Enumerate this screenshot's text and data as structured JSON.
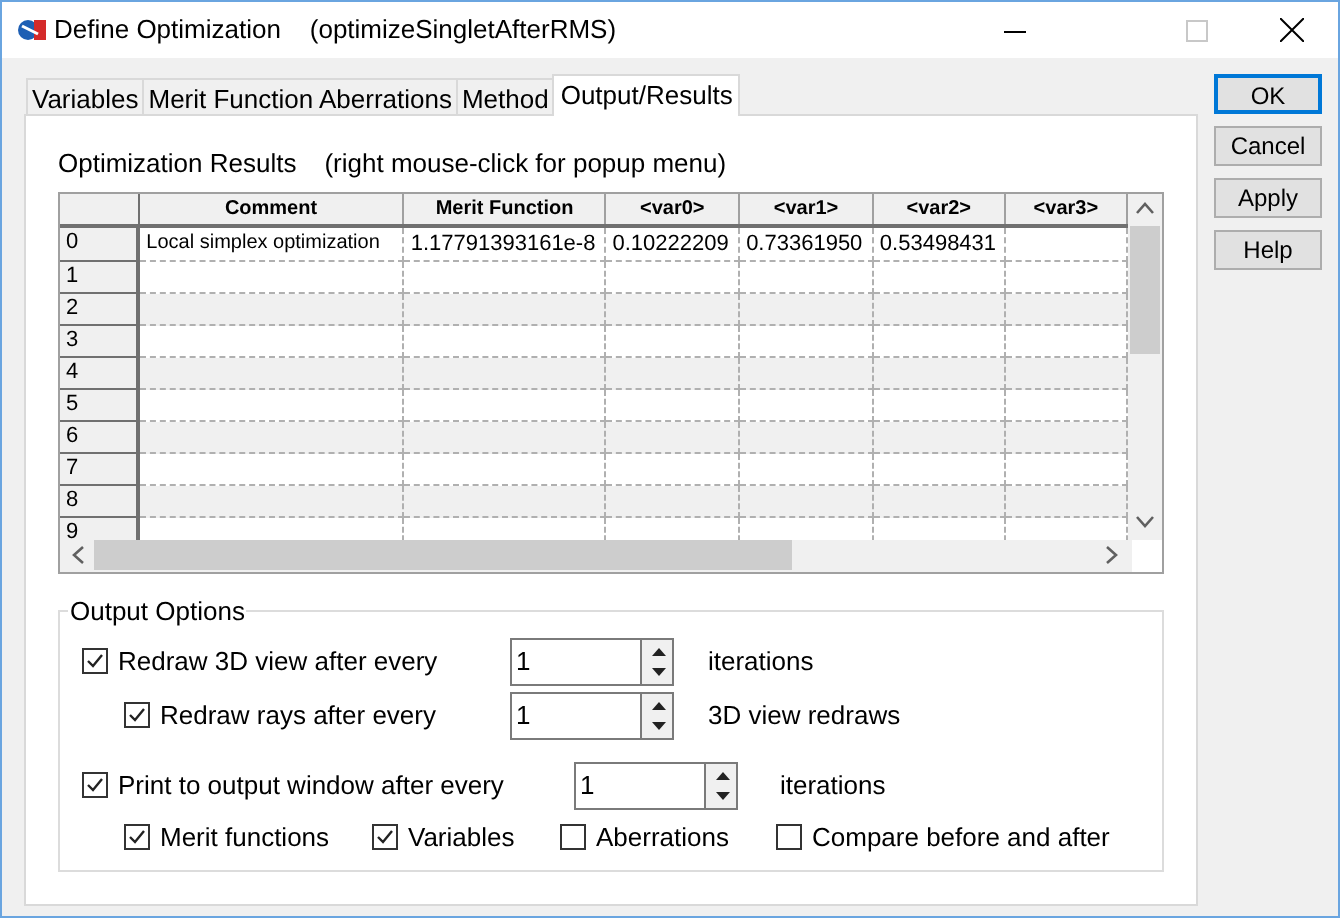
{
  "window": {
    "title": "Define Optimization",
    "subtitle": "(optimizeSingletAfterRMS)"
  },
  "tabs": [
    {
      "label": "Variables",
      "selected": false
    },
    {
      "label": "Merit Function Aberrations",
      "selected": false
    },
    {
      "label": "Method",
      "selected": false
    },
    {
      "label": "Output/Results",
      "selected": true
    }
  ],
  "results": {
    "title": "Optimization Results",
    "hint": "(right mouse-click for popup menu)",
    "columns": [
      "Comment",
      "Merit Function",
      "<var0>",
      "<var1>",
      "<var2>",
      "<var3>"
    ],
    "rows": [
      {
        "row": "0",
        "cells": [
          "Local simplex optimization",
          "1.17791393161e-8",
          "0.10222209",
          "0.73361950",
          "0.53498431"
        ]
      },
      {
        "row": "1"
      },
      {
        "row": "2"
      },
      {
        "row": "3"
      },
      {
        "row": "4"
      },
      {
        "row": "5"
      },
      {
        "row": "6"
      },
      {
        "row": "7"
      },
      {
        "row": "8"
      },
      {
        "row": "9"
      }
    ]
  },
  "output_options": {
    "title": "Output Options",
    "options": [
      {
        "label": "Redraw 3D view after every",
        "checked": true,
        "value": "1",
        "unit": "iterations",
        "children": [
          {
            "label": "Redraw rays after every",
            "checked": true,
            "value": "1",
            "unit": "3D view redraws"
          }
        ]
      },
      {
        "label": "Print to output window after every",
        "checked": true,
        "value": "1",
        "unit": "iterations",
        "children": [
          {
            "label": "Merit functions",
            "checked": true
          },
          {
            "label": "Variables",
            "checked": true
          },
          {
            "label": "Aberrations",
            "checked": false
          },
          {
            "label": "Compare before and after",
            "checked": false
          }
        ]
      }
    ]
  },
  "buttons": [
    {
      "label": "OK",
      "default": true
    },
    {
      "label": "Cancel",
      "default": false
    },
    {
      "label": "Apply",
      "default": false
    },
    {
      "label": "Help",
      "default": false
    }
  ]
}
